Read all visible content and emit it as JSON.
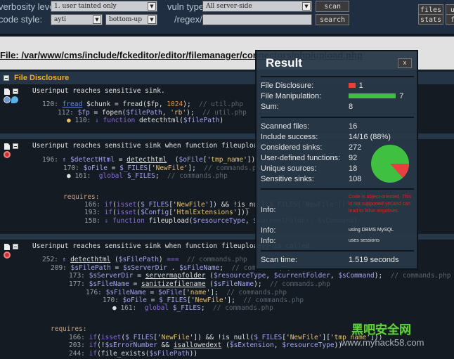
{
  "toolbar": {
    "verbosity_label": "verbosity level:",
    "verbosity_value": "1. user tainted only",
    "code_style_label": "code style:",
    "code_style_value": "ayti",
    "order_value": "bottom-up",
    "vuln_type_label": "vuln type:",
    "vuln_type_value": "All server-side",
    "regex_label": "/regex/:",
    "regex_value": "",
    "scan_label": "scan",
    "search_label": "search",
    "files_label": "files",
    "stats_label": "stats",
    "user_label": "u",
    "f_label": "f"
  },
  "file_path": "File: /var/www/cms/include/fckeditor/editor/filemanager/connectors/php/upload.php",
  "section_title": "File Disclosure",
  "blocks": [
    {
      "title": "Userinput reaches sensitive sink.",
      "lines": [
        [
          [
            "120: ",
            "n"
          ],
          [
            "fread",
            "fb"
          ],
          [
            " $chunk = fread($fp, ",
            "d"
          ],
          [
            "1024",
            "num"
          ],
          [
            ");  ",
            "d"
          ],
          [
            "// util.php",
            "c"
          ]
        ],
        [
          [
            "112: ",
            "n"
          ],
          [
            "$fp",
            "v"
          ],
          [
            " = fopen(",
            "d"
          ],
          [
            "$filePath",
            "v"
          ],
          [
            ", ",
            "d"
          ],
          [
            "'rb'",
            "s"
          ],
          [
            ");  ",
            "d"
          ],
          [
            "// util.php",
            "c"
          ]
        ],
        [
          [
            "● ",
            "s"
          ],
          [
            "110: ",
            "n"
          ],
          [
            "⇓ function",
            "k"
          ],
          [
            " detecthtml(",
            "d"
          ],
          [
            "$filePath",
            "v"
          ],
          [
            ")",
            "d"
          ]
        ]
      ]
    },
    {
      "title": "Userinput reaches sensitive sink when function fileupload() is called.",
      "lines": [
        [
          [
            "196: ",
            "n"
          ],
          [
            "⇑ $detectHtml",
            "v"
          ],
          [
            " = ",
            "d"
          ],
          [
            "detecthtml",
            "f"
          ],
          [
            "  (",
            "d"
          ],
          [
            "$oFile",
            "v"
          ],
          [
            "['",
            "d"
          ],
          [
            "tmp_name",
            "s"
          ],
          [
            "'])) ",
            "d"
          ],
          [
            "===",
            "k"
          ]
        ],
        [
          [
            "170: ",
            "n"
          ],
          [
            "$oFile",
            "v"
          ],
          [
            " = ",
            "d"
          ],
          [
            "$_FILES",
            "v"
          ],
          [
            "['",
            "d"
          ],
          [
            "NewFile",
            "s"
          ],
          [
            "'];  ",
            "d"
          ],
          [
            "// commands.php",
            "c"
          ]
        ],
        [
          [
            "● ",
            "d"
          ],
          [
            "161:  ",
            "n"
          ],
          [
            "global",
            "k"
          ],
          [
            " $_FILES",
            "v"
          ],
          [
            ";  ",
            "d"
          ],
          [
            "// commands.php",
            "c"
          ]
        ],
        [
          [
            "requires:",
            "r"
          ]
        ],
        [
          [
            "166: ",
            "n"
          ],
          [
            "if",
            "k"
          ],
          [
            "(",
            "d"
          ],
          [
            "isset",
            "k"
          ],
          [
            "(",
            "d"
          ],
          [
            "$_FILES",
            "v"
          ],
          [
            "['",
            "d"
          ],
          [
            "NewFile",
            "s"
          ],
          [
            "']) && !is_null($_FILES['NewFile']['tmp_name']))",
            "d"
          ]
        ],
        [
          [
            "193: ",
            "n"
          ],
          [
            "if",
            "k"
          ],
          [
            "(",
            "d"
          ],
          [
            "isset",
            "k"
          ],
          [
            "(",
            "d"
          ],
          [
            "$Config",
            "v"
          ],
          [
            "['",
            "d"
          ],
          [
            "HtmlExtensions",
            "s"
          ],
          [
            "']))",
            "d"
          ]
        ],
        [
          [
            "158: ",
            "n"
          ],
          [
            "⇓ function",
            "k"
          ],
          [
            " fileupload(",
            "d"
          ],
          [
            "$resourceType",
            "v"
          ],
          [
            ", ",
            "d"
          ],
          [
            "$currentFolder, $sCommand",
            "v"
          ],
          [
            ")",
            "d"
          ]
        ]
      ]
    },
    {
      "title": "Userinput reaches sensitive sink when function fileupload() is called.",
      "lines": [
        [
          [
            "252: ",
            "n"
          ],
          [
            "⇑ ",
            "v"
          ],
          [
            "detecthtml",
            "f"
          ],
          [
            " (",
            "d"
          ],
          [
            "$sFilePath",
            "v"
          ],
          [
            ") ",
            "d"
          ],
          [
            "===",
            "k"
          ],
          [
            "  // commands.php",
            "c"
          ]
        ],
        [
          [
            "209: ",
            "n"
          ],
          [
            "$sFilePath",
            "v"
          ],
          [
            " = ",
            "d"
          ],
          [
            "$sServerDir",
            "v"
          ],
          [
            " . ",
            "d"
          ],
          [
            "$sFileName",
            "v"
          ],
          [
            ";  ",
            "d"
          ],
          [
            "// commands.php",
            "c"
          ]
        ],
        [
          [
            "173: ",
            "n"
          ],
          [
            "$sServerDir",
            "v"
          ],
          [
            " = ",
            "d"
          ],
          [
            "servermapfolder",
            "f"
          ],
          [
            " (",
            "d"
          ],
          [
            "$resourceType",
            "v"
          ],
          [
            ", ",
            "d"
          ],
          [
            "$currentFolder",
            "v"
          ],
          [
            ", ",
            "d"
          ],
          [
            "$sCommand",
            "v"
          ],
          [
            ");  ",
            "d"
          ],
          [
            "// commands.php",
            "c"
          ]
        ],
        [
          [
            "177: ",
            "n"
          ],
          [
            "$sFileName",
            "v"
          ],
          [
            " = ",
            "d"
          ],
          [
            "sanitizefilename",
            "f"
          ],
          [
            " (",
            "d"
          ],
          [
            "$sFileName",
            "v"
          ],
          [
            ");  ",
            "d"
          ],
          [
            "// commands.php",
            "c"
          ]
        ],
        [
          [
            "176: ",
            "n"
          ],
          [
            "$sFileName",
            "v"
          ],
          [
            " = ",
            "d"
          ],
          [
            "$oFile",
            "v"
          ],
          [
            "['",
            "d"
          ],
          [
            "name",
            "s"
          ],
          [
            "'];  ",
            "d"
          ],
          [
            "// commands.php",
            "c"
          ]
        ],
        [
          [
            "170: ",
            "n"
          ],
          [
            "$oFile",
            "v"
          ],
          [
            " = ",
            "d"
          ],
          [
            "$_FILES",
            "v"
          ],
          [
            "['",
            "d"
          ],
          [
            "NewFile",
            "s"
          ],
          [
            "'];  ",
            "d"
          ],
          [
            "// commands.php",
            "c"
          ]
        ],
        [
          [
            "● ",
            "d"
          ],
          [
            "161:  ",
            "n"
          ],
          [
            "global",
            "k"
          ],
          [
            " $_FILES",
            "v"
          ],
          [
            ";  ",
            "d"
          ],
          [
            "// commands.php",
            "c"
          ]
        ],
        [
          [
            "requires:",
            "r"
          ]
        ],
        [
          [
            "166: ",
            "n"
          ],
          [
            "if",
            "k"
          ],
          [
            "(",
            "d"
          ],
          [
            "isset",
            "k"
          ],
          [
            "(",
            "d"
          ],
          [
            "$_FILES",
            "v"
          ],
          [
            "['",
            "d"
          ],
          [
            "NewFile",
            "s"
          ],
          [
            "']) && !is_null(",
            "d"
          ],
          [
            "$_FILES",
            "v"
          ],
          [
            "['",
            "d"
          ],
          [
            "NewFile",
            "s"
          ],
          [
            "']['",
            "d"
          ],
          [
            "tmp_name",
            "s"
          ],
          [
            "']))",
            "d"
          ]
        ],
        [
          [
            "203: ",
            "n"
          ],
          [
            "if",
            "k"
          ],
          [
            "(!",
            "d"
          ],
          [
            "$sErrorNumber",
            "v"
          ],
          [
            " && ",
            "d"
          ],
          [
            "isallowedext",
            "f"
          ],
          [
            " (",
            "d"
          ],
          [
            "$sExtension",
            "v"
          ],
          [
            ", ",
            "d"
          ],
          [
            "$resourceType",
            "v"
          ],
          [
            "))",
            "d"
          ]
        ],
        [
          [
            "244: ",
            "n"
          ],
          [
            "if",
            "k"
          ],
          [
            "(file_exists(",
            "d"
          ],
          [
            "$sFilePath",
            "v"
          ],
          [
            "))",
            "d"
          ]
        ]
      ]
    }
  ],
  "result": {
    "title": "Result",
    "close": "x",
    "stats": [
      {
        "label": "File Disclosure:",
        "value": "1"
      },
      {
        "label": "File Manipulation:",
        "value": "7"
      },
      {
        "label": "Sum:",
        "value": "8"
      }
    ],
    "scan": [
      {
        "label": "Scanned files:",
        "value": "16"
      },
      {
        "label": "Include success:",
        "value": "14/16 (88%)"
      },
      {
        "label": "Considered sinks:",
        "value": "272"
      },
      {
        "label": "User-defined functions:",
        "value": "92"
      },
      {
        "label": "Unique sources:",
        "value": "18"
      },
      {
        "label": "Sensitive sinks:",
        "value": "108"
      }
    ],
    "info": [
      {
        "label": "Info:",
        "value": "Code is object-oriented. This is not supported yet and can lead to false negatives."
      },
      {
        "label": "Info:",
        "value": "using DBMS MySQL"
      },
      {
        "label": "Info:",
        "value": "uses sessions"
      }
    ],
    "scan_time_label": "Scan time:",
    "scan_time": "1.519 seconds",
    "colors": {
      "file_disclosure": "#e84040",
      "file_manipulation": "#40c040"
    }
  },
  "watermark": {
    "text": "黑吧安全网",
    "url": "www.myhack58.com"
  }
}
